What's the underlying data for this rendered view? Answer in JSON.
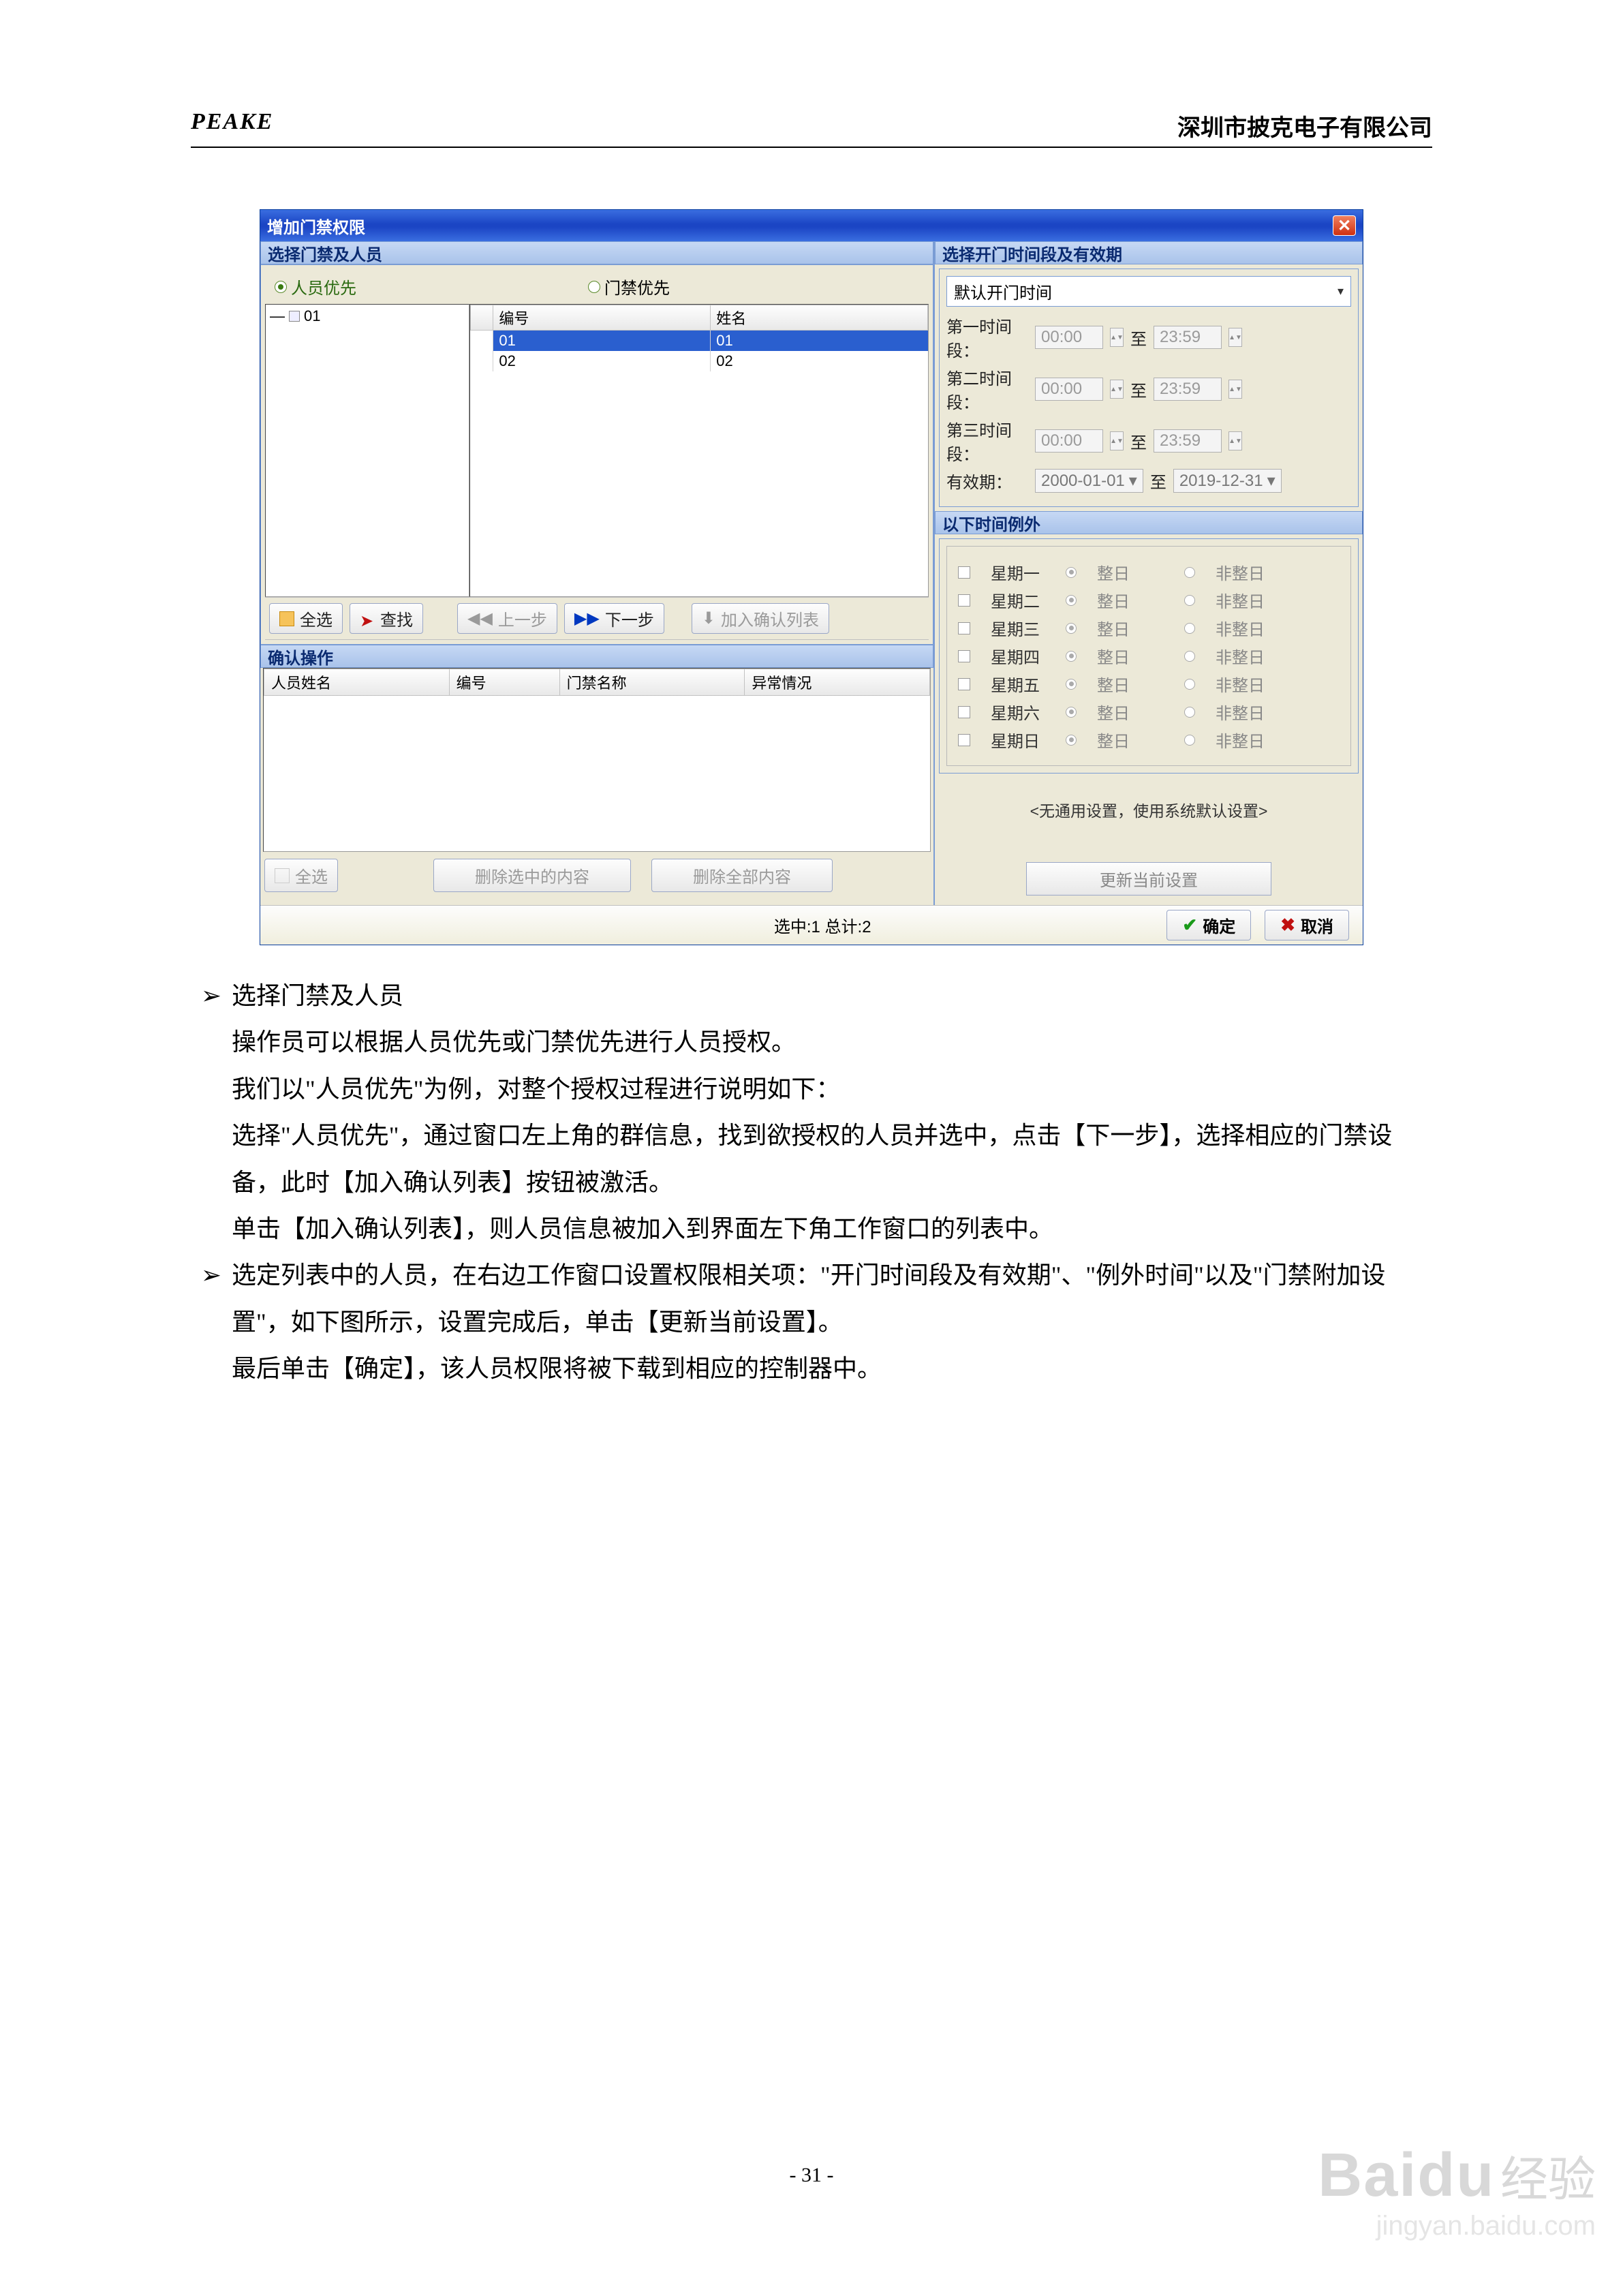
{
  "header": {
    "brand": "PEAKE",
    "company": "深圳市披克电子有限公司"
  },
  "dialog": {
    "title": "增加门禁权限",
    "left_header": "选择门禁及人员",
    "right_header": "选择开门时间段及有效期",
    "radio_person": "人员优先",
    "radio_gate": "门禁优先",
    "tree_root": "01",
    "grid": {
      "cols": [
        "编号",
        "姓名"
      ],
      "rows": [
        {
          "id": "01",
          "name": "01",
          "selected": true
        },
        {
          "id": "02",
          "name": "02",
          "selected": false
        }
      ]
    },
    "btn_selectall": "全选",
    "btn_find": "查找",
    "btn_prev": "上一步",
    "btn_next": "下一步",
    "btn_addconfirm": "加入确认列表",
    "confirm_header": "确认操作",
    "confirm_cols": [
      "人员姓名",
      "编号",
      "门禁名称",
      "异常情况"
    ],
    "btn_selectall2": "全选",
    "btn_delsel": "删除选中的内容",
    "btn_delall": "删除全部内容",
    "status": "选中:1 总计:2",
    "ok": "确定",
    "cancel": "取消"
  },
  "right": {
    "combo": "默认开门时间",
    "t1": "第一时间段：",
    "t2": "第二时间段：",
    "t3": "第三时间段：",
    "from": "00:00",
    "to": "23:59",
    "zhi": "至",
    "valid_label": "有效期：",
    "valid_from": "2000-01-01",
    "valid_to": "2019-12-31",
    "exc_header": "以下时间例外",
    "days": [
      "星期一",
      "星期二",
      "星期三",
      "星期四",
      "星期五",
      "星期六",
      "星期日"
    ],
    "whole": "整日",
    "notwhole": "非整日",
    "noset": "<无通用设置，使用系统默认设置>",
    "update": "更新当前设置"
  },
  "prose": {
    "b1_title": "选择门禁及人员",
    "b1_l1": "操作员可以根据人员优先或门禁优先进行人员授权。",
    "b1_l2": "我们以\"人员优先\"为例，对整个授权过程进行说明如下：",
    "b1_l3": "选择\"人员优先\"，通过窗口左上角的群信息，找到欲授权的人员并选中，点击【下一步】，选择相应的门禁设备，此时【加入确认列表】按钮被激活。",
    "b1_l4": "单击【加入确认列表】，则人员信息被加入到界面左下角工作窗口的列表中。",
    "b2_l1": "选定列表中的人员，在右边工作窗口设置权限相关项：\"开门时间段及有效期\"、\"例外时间\"以及\"门禁附加设置\"，如下图所示，设置完成后，单击【更新当前设置】。",
    "b2_l2": "最后单击【确定】，该人员权限将被下载到相应的控制器中。"
  },
  "page_number": "- 31 -",
  "watermark": {
    "brand": "Bai",
    "brand2": "du",
    "cn": "经验",
    "url": "jingyan.baidu.com"
  }
}
